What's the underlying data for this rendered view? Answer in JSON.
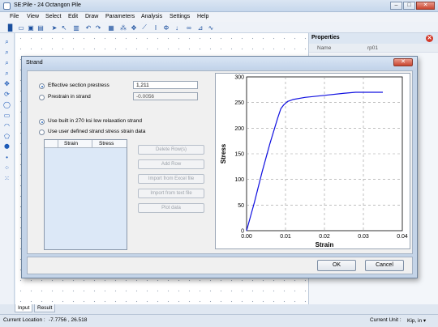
{
  "window": {
    "title": "SE:Pile - 24 Octangon Pile",
    "minimize": "–",
    "maximize": "□",
    "close": "✕"
  },
  "menu": [
    "File",
    "View",
    "Select",
    "Edit",
    "Draw",
    "Parameters",
    "Analysis",
    "Settings",
    "Help"
  ],
  "properties": {
    "title": "Properties",
    "row_name_label": "Name",
    "row_name_value": "rp01"
  },
  "dialog": {
    "title": "Strand",
    "effective_prestress_label": "Effective section prestress",
    "effective_prestress_value": "1,211",
    "prestrain_label": "Prestrain in strand",
    "prestrain_value": "-0.0056",
    "builtin_label": "Use built in 270 ksi low relaxation strand",
    "userdefined_label": "Use user defined strand stress strain data",
    "grid_columns": [
      "Strain",
      "Stress"
    ],
    "buttons": {
      "delete_rows": "Delete Row(s)",
      "add_row": "Add Row",
      "import_excel": "Import from Excel file",
      "import_text": "Import from text file",
      "plot_data": "Plot data"
    },
    "ok": "OK",
    "cancel": "Cancel",
    "close": "✕"
  },
  "tabs": [
    "Input",
    "Result"
  ],
  "status": {
    "location_label": "Current Location :",
    "location_value": "-7.7756 , 26.518",
    "unit_label": "Current Unit :",
    "unit_value": "Kip, in ▾"
  },
  "chart_data": {
    "type": "line",
    "title": "",
    "xlabel": "Strain",
    "ylabel": "Stress",
    "xlim": [
      0,
      0.04
    ],
    "ylim": [
      0,
      300
    ],
    "xticks": [
      "0.00",
      "0.01",
      "0.02",
      "0.03",
      "0.04"
    ],
    "yticks": [
      "0",
      "50",
      "100",
      "150",
      "200",
      "250",
      "300"
    ],
    "grid": true,
    "series": [
      {
        "color": "#1010e0",
        "x": [
          0,
          0.002,
          0.004,
          0.006,
          0.008,
          0.0088,
          0.0095,
          0.0105,
          0.012,
          0.015,
          0.02,
          0.025,
          0.028,
          0.03,
          0.035
        ],
        "y": [
          0,
          55,
          115,
          170,
          220,
          238,
          245,
          252,
          256,
          260,
          264,
          268,
          270,
          270,
          270
        ]
      }
    ]
  }
}
